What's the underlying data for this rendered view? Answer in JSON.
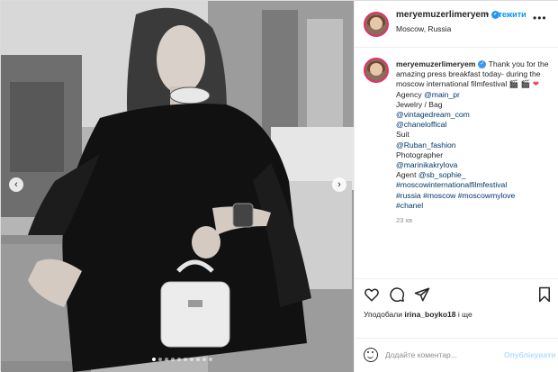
{
  "post": {
    "header": {
      "username": "meryemuzerlimeryem",
      "separator": "•",
      "follow_label": "Стежити",
      "location": "Moscow, Russia",
      "more_icon": "more-dots-icon"
    },
    "caption": {
      "username": "meryemuzerlimeryem",
      "intro": "Thank you for the amazing press breakfast today- during the moscow international filmfestival",
      "emoji_icons": [
        "clapper-icon",
        "clapper-icon",
        "heart-icon"
      ],
      "lines": [
        {
          "text": "Agency ",
          "link": "@main_pr"
        },
        {
          "text": "Jewelry / Bag",
          "link": ""
        },
        {
          "text": "",
          "link": "@vintagedream_com"
        },
        {
          "text": "",
          "link": "@chaneloffical"
        },
        {
          "text": "Suit",
          "link": ""
        },
        {
          "text": "",
          "link": "@Ruban_fashion"
        },
        {
          "text": "Photographer",
          "link": ""
        },
        {
          "text": "",
          "link": "@marinikakrylova"
        },
        {
          "text": "Agent ",
          "link": "@sb_sophie_"
        },
        {
          "text": "",
          "link": "#moscowinternationalfilmfestival"
        },
        {
          "text": "",
          "link": "#russia #moscow #moscowmylove"
        },
        {
          "text": "",
          "link": "#chanel"
        }
      ],
      "time": "23 хв"
    },
    "actions": {
      "like_icon": "heart-icon",
      "comment_icon": "comment-icon",
      "share_icon": "send-icon",
      "save_icon": "bookmark-icon"
    },
    "likes": {
      "prefix": "Уподобали",
      "user": "irina_boyko18",
      "suffix": "і ще"
    },
    "comment": {
      "placeholder": "Додайте коментар...",
      "publish_label": "Опублікувати"
    },
    "carousel": {
      "slide_count": 10,
      "active_index": 0
    }
  },
  "colors": {
    "link": "#00376b",
    "accent": "#0095f6",
    "publish_disabled": "#b2dffc",
    "border": "#dbdbdb"
  }
}
